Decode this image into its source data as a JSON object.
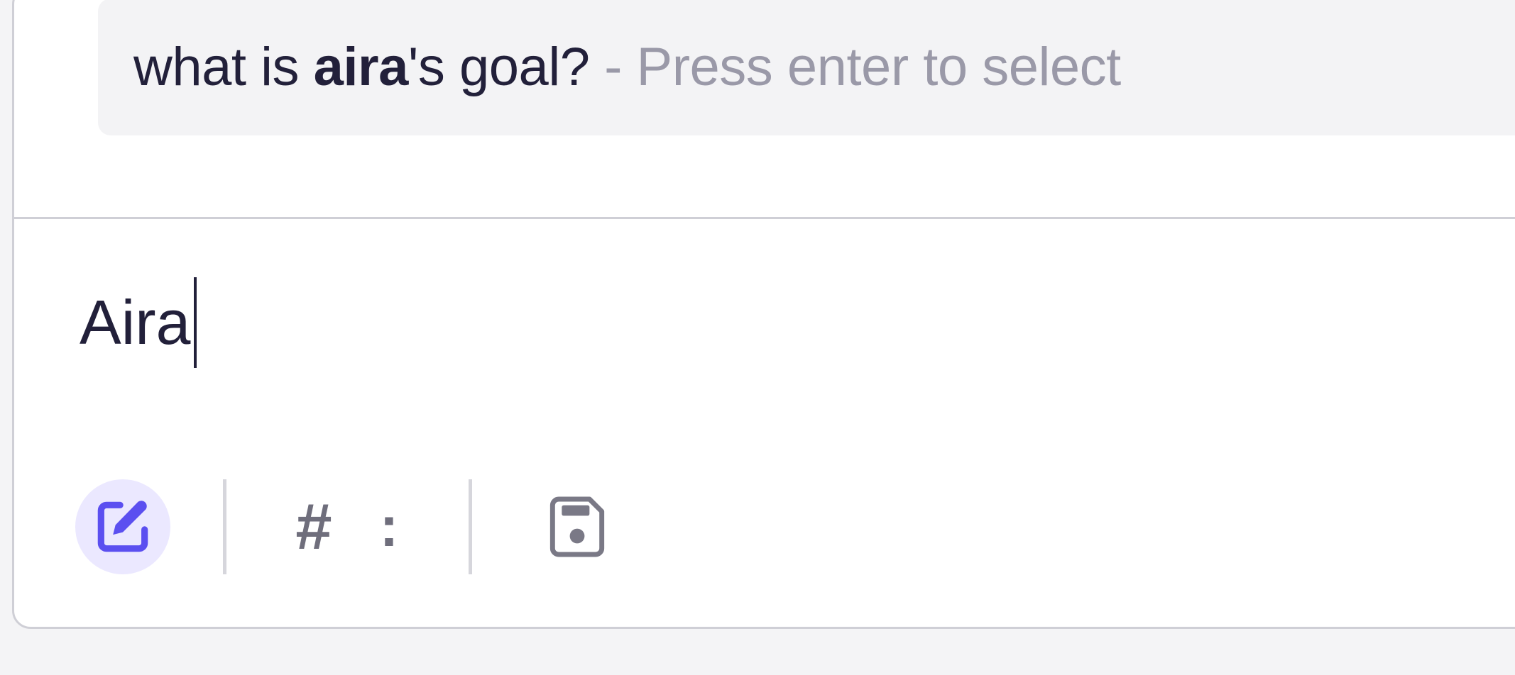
{
  "suggestion": {
    "prefix": "what is ",
    "match": "aira",
    "suffix": "'s goal?",
    "hint": " - Press enter to select"
  },
  "editor": {
    "value": "Aira"
  },
  "toolbar": {
    "hash_label": "#",
    "colon_label": ":",
    "icons": [
      "edit-note-icon",
      "save-icon"
    ]
  },
  "colors": {
    "accent": "#5b4ff0",
    "accent_bg": "#ebe8ff",
    "text": "#22203a",
    "hint": "#9a99a8"
  }
}
